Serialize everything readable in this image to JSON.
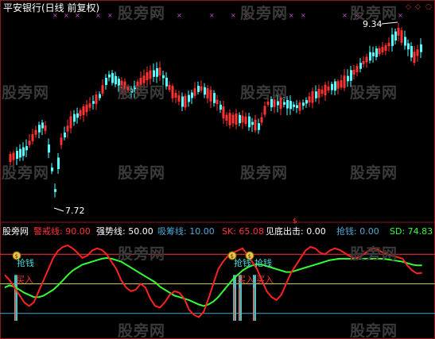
{
  "header": {
    "title": "平安银行(日线 前复权)",
    "title_color": "#ffffff",
    "signal_marks_count": 2,
    "controls": [
      "◇",
      "◇",
      "○"
    ]
  },
  "watermark": "股旁网",
  "price_panel": {
    "high_label": "9.34",
    "low_label": "7.72",
    "up_color": "#ff3333",
    "down_color": "#55ffff"
  },
  "indicator_panel": {
    "name": "股旁网",
    "items": [
      {
        "label": "警戒线:",
        "value": "90.00",
        "color": "#ff3333"
      },
      {
        "label": "强势线:",
        "value": "50.00",
        "color": "#ffffff"
      },
      {
        "label": "吸筹线:",
        "value": "10.00",
        "color": "#4fa9d9"
      },
      {
        "label": "SK:",
        "value": "65.08",
        "color": "#ff3333"
      },
      {
        "label": "见底出击:",
        "value": "0.00",
        "color": "#ffffff"
      },
      {
        "label": "抢钱:",
        "value": "0.00",
        "color": "#4fa9d9"
      },
      {
        "label": "SD:",
        "value": "74.83",
        "color": "#33ff33"
      }
    ],
    "annotations": [
      {
        "text": "抢钱",
        "color": "#4ad9d9"
      },
      {
        "text": "抢钱",
        "color": "#4ad9d9"
      },
      {
        "text": "抢钱",
        "color": "#4ad9d9"
      },
      {
        "text": "买入",
        "color": "#ff3333"
      },
      {
        "text": "买入",
        "color": "#ff3333"
      },
      {
        "text": "买入",
        "color": "#ff3333"
      }
    ],
    "bag_icon": "money-bag-icon"
  },
  "chart_data": {
    "type": "candlestick+line",
    "title": "平安银行(日线 前复权)",
    "price": {
      "max_label": 9.34,
      "min_label": 7.72
    },
    "indicator": {
      "warning_line": 90,
      "strong_line": 50,
      "accumulate_line": 10,
      "sk_last": 65.08,
      "sd_last": 74.83,
      "sk": [
        62,
        55,
        45,
        35,
        25,
        20,
        25,
        40,
        55,
        70,
        85,
        95,
        100,
        102,
        98,
        92,
        85,
        88,
        95,
        98,
        96,
        90,
        80,
        70,
        55,
        45,
        40,
        42,
        50,
        45,
        30,
        20,
        18,
        25,
        35,
        40,
        38,
        30,
        15,
        8,
        5,
        12,
        30,
        50,
        70,
        80,
        88,
        92,
        95,
        98,
        90,
        80,
        70,
        55,
        40,
        32,
        28,
        35,
        50,
        65,
        75,
        85,
        95,
        100,
        98,
        92,
        90,
        95,
        98,
        96,
        92,
        88,
        85,
        86,
        90,
        95,
        98,
        96,
        92,
        90,
        88,
        86,
        84,
        75,
        68,
        64,
        65
      ],
      "sd": [
        45,
        48,
        46,
        42,
        38,
        35,
        32,
        32,
        34,
        38,
        42,
        48,
        55,
        62,
        68,
        72,
        76,
        78,
        80,
        82,
        84,
        85,
        84,
        82,
        80,
        76,
        72,
        68,
        64,
        60,
        56,
        52,
        46,
        42,
        38,
        34,
        32,
        30,
        28,
        25,
        22,
        20,
        22,
        26,
        32,
        40,
        48,
        56,
        62,
        68,
        72,
        75,
        76,
        76,
        74,
        72,
        70,
        68,
        66,
        66,
        68,
        70,
        72,
        74,
        76,
        78,
        80,
        82,
        83,
        84,
        84,
        84,
        84,
        84,
        84,
        84,
        84,
        84,
        84,
        83,
        82,
        81,
        80,
        78,
        76,
        75,
        75
      ]
    }
  }
}
